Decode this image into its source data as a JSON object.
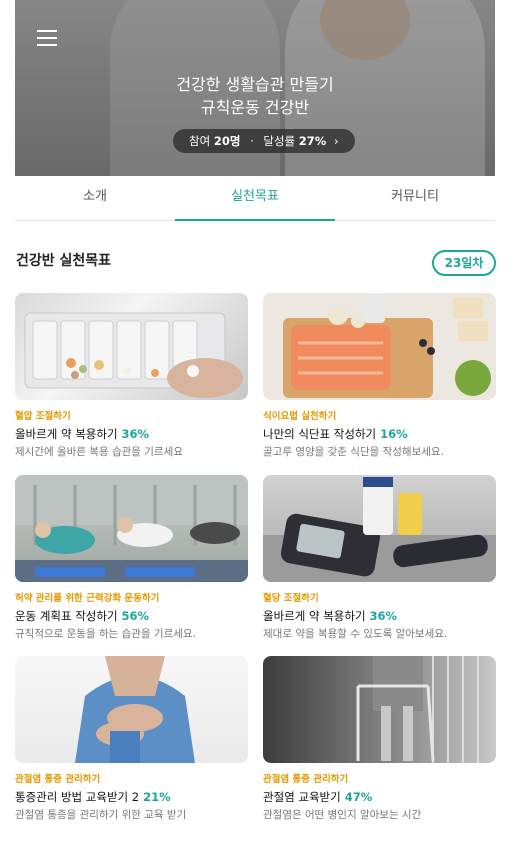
{
  "hero": {
    "title_line1": "건강한 생활습관 만들기",
    "title_line2": "규칙운동 건강반",
    "participants_label": "참여",
    "participants": "20명",
    "separator": "·",
    "achievement_label": "달성률",
    "achievement": "27%",
    "chevron": "›"
  },
  "tabs": [
    {
      "label": "소개"
    },
    {
      "label": "실천목표"
    },
    {
      "label": "커뮤니티"
    }
  ],
  "section": {
    "title": "건강반 실천목표",
    "day_badge": "23일차"
  },
  "cards": [
    {
      "category": "혈압 조절하기",
      "name": "올바르게 약 복용하기",
      "percent": "36%",
      "desc": "제시간에 올바른 복용 습관을 기르세요"
    },
    {
      "category": "식이요법 실천하기",
      "name": "나만의 식단표 작성하기",
      "percent": "16%",
      "desc": "골고루 영양을 갖춘 식단을 작성해보세요."
    },
    {
      "category": "허약 관리를 위한 근력강화 운동하기",
      "name": "운동 계획표 작성하기",
      "percent": "56%",
      "desc": "규칙적으로 운동을 하는 습관을 기르세요."
    },
    {
      "category": "혈당 조절하기",
      "name": "올바르게 약 복용하기",
      "percent": "36%",
      "desc": "제대로 약을 복용할 수 있도록 알아보세요."
    },
    {
      "category": "관절염 통증 관리하기",
      "name": "통증관리 방법 교육받기 2",
      "percent": "21%",
      "desc": "관절염 통증을 관리하기 위한 교육 받기"
    },
    {
      "category": "관절염 통증 관리하기",
      "name": "관절염 교육받기",
      "percent": "47%",
      "desc": "관절염은 어떤 병인지 알아보는 시간"
    }
  ],
  "colors": {
    "accent": "#1aa79a",
    "category": "#e39a00"
  }
}
